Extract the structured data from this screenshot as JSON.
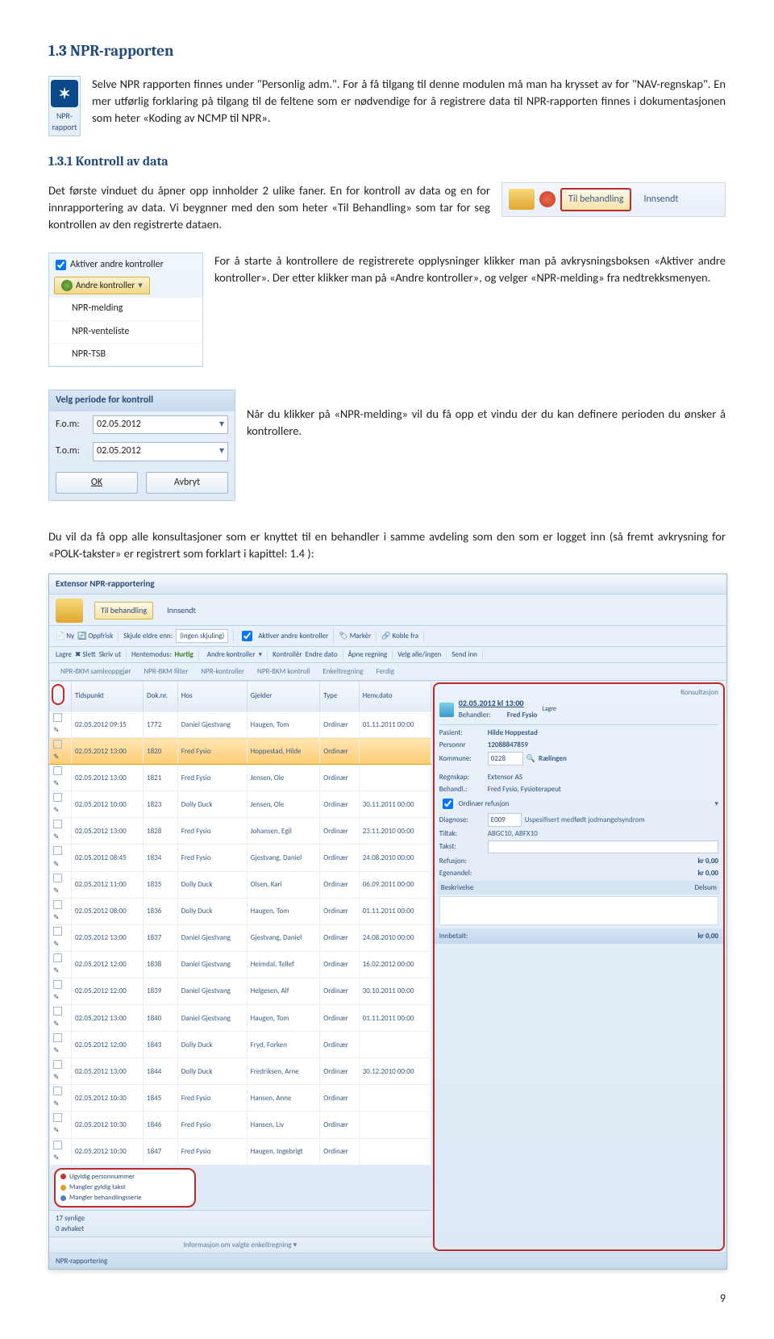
{
  "headings": {
    "h1_3": "1.3   NPR-rapporten",
    "h1_3_1": "1.3.1   Kontroll av data"
  },
  "npr_icon_label": "NPR-rapport",
  "npr_icon_glyph": "✶",
  "para": {
    "p1": "Selve NPR rapporten finnes under \"Personlig adm.\". For å få tilgang til denne modulen må man ha krysset av for \"NAV-regnskap\". En mer utførlig forklaring på tilgang til de feltene som er nødvendige for å registrere data til NPR-rapporten finnes i dokumentasjonen som heter «Koding av NCMP til NPR».",
    "p2": "Det første vinduet du åpner opp innholder 2 ulike faner. En for kontroll av data og en for innrapportering av data. Vi beygnner med den som heter «Til Behandling» som tar for seg kontrollen av den registrerte dataen.",
    "p3": "For å starte å kontrollere de registrerete opplysninger klikker man på avkrysningsboksen «Aktiver andre kontroller». Der etter klikker man på «Andre kontroller», og velger «NPR-melding» fra nedtrekksmenyen.",
    "p4": "Når du klikker på «NPR-melding» vil du få opp et vindu der du kan definere perioden du ønsker å kontrollere.",
    "p5": "Du vil da få opp alle konsultasjoner som er knyttet til en behandler i samme avdeling som den som er logget inn (så fremt avkrysning for «POLK-takster» er registrert som forklart i kapittel: 1.4 ):"
  },
  "tabs_img": {
    "tab1": "Til behandling",
    "tab2": "Innsendt"
  },
  "kontroll": {
    "checkbox_label": "Aktiver andre kontroller",
    "button_label": "Andre kontroller",
    "items": [
      "NPR-melding",
      "NPR-venteliste",
      "NPR-TSB"
    ]
  },
  "periode": {
    "title": "Velg periode for kontroll",
    "fom_lbl": "F.o.m:",
    "tom_lbl": "T.o.m:",
    "fom_val": "02.05.2012",
    "tom_val": "02.05.2012",
    "ok": "OK",
    "cancel": "Avbryt"
  },
  "bigshot": {
    "title": "Extensor NPR-rapportering",
    "top_tabs": {
      "t1": "Til behandling",
      "t2": "Innsendt"
    },
    "tb2": {
      "ny": "Ny",
      "oppfr": "Oppfrisk",
      "skjul": "Skjule eldre enn:",
      "skjul_val": "(ingen skjuling)",
      "aktiver": "Aktiver andre kontroller",
      "marker": "Markèr",
      "koble": "Koble fra",
      "lagre": "Lagre",
      "slett": "Slett",
      "skriv": "Skriv ut",
      "hente": "Hentemodus:",
      "hurtig": "Hurtig",
      "andre": "Andre kontroller",
      "kontrollr": "Kontrollèr",
      "endre": "Endre dato",
      "apne": "Åpne regning",
      "velg": "Velg alle/ingen",
      "send": "Send inn"
    },
    "tb3": [
      "NPR-BKM samleoppgjør",
      "NPR-BKM filter",
      "NPR-kontroller",
      "NPR-BKM kontroll",
      "Enkeltregning",
      "Ferdig"
    ],
    "cols": [
      "",
      "Tidspunkt",
      "Dok.nr.",
      "Hos",
      "Gjelder",
      "Type",
      "Henv.dato"
    ],
    "rows": [
      [
        "",
        "02.05.2012 09:15",
        "1772",
        "Daniel Gjestvang",
        "Haugen, Tom",
        "Ordinær",
        "01.11.2011 00:00"
      ],
      [
        "",
        "02.05.2012 13:00",
        "1820",
        "Fred Fysio",
        "Hoppestad, Hilde",
        "Ordinær",
        ""
      ],
      [
        "",
        "02.05.2012 13:00",
        "1821",
        "Fred Fysio",
        "Jensen, Ole",
        "Ordinær",
        ""
      ],
      [
        "",
        "02.05.2012 10:00",
        "1823",
        "Dolly Duck",
        "Jensen, Ole",
        "Ordinær",
        "30.11.2011 00:00"
      ],
      [
        "",
        "02.05.2012 13:00",
        "1828",
        "Fred Fysio",
        "Johansen, Egil",
        "Ordinær",
        "23.11.2010 00:00"
      ],
      [
        "",
        "02.05.2012 08:45",
        "1834",
        "Fred Fysio",
        "Gjestvang, Daniel",
        "Ordinær",
        "24.08.2010 00:00"
      ],
      [
        "",
        "02.05.2012 11:00",
        "1835",
        "Dolly Duck",
        "Olsen, Kari",
        "Ordinær",
        "06.09.2011 00:00"
      ],
      [
        "",
        "02.05.2012 08:00",
        "1836",
        "Dolly Duck",
        "Haugen, Tom",
        "Ordinær",
        "01.11.2011 00:00"
      ],
      [
        "",
        "02.05.2012 13:00",
        "1837",
        "Daniel Gjestvang",
        "Gjestvang, Daniel",
        "Ordinær",
        "24.08.2010 00:00"
      ],
      [
        "",
        "02.05.2012 12:00",
        "1838",
        "Daniel Gjestvang",
        "Heimdal, Tellef",
        "Ordinær",
        "16.02.2012 00:00"
      ],
      [
        "",
        "02.05.2012 12:00",
        "1839",
        "Daniel Gjestvang",
        "Helgesen, Alf",
        "Ordinær",
        "30.10.2011 00:00"
      ],
      [
        "",
        "02.05.2012 13:00",
        "1840",
        "Daniel Gjestvang",
        "Haugen, Tom",
        "Ordinær",
        "01.11.2011 00:00"
      ],
      [
        "",
        "02.05.2012 12:00",
        "1843",
        "Dolly Duck",
        "Fryd, Forken",
        "Ordinær",
        ""
      ],
      [
        "",
        "02.05.2012 13:00",
        "1844",
        "Dolly Duck",
        "Fredriksen, Arne",
        "Ordinær",
        "30.12.2010 00:00"
      ],
      [
        "",
        "02.05.2012 10:30",
        "1845",
        "Fred Fysio",
        "Hansen, Anne",
        "Ordinær",
        ""
      ],
      [
        "",
        "02.05.2012 10:30",
        "1846",
        "Fred Fysio",
        "Hansen, Liv",
        "Ordinær",
        ""
      ],
      [
        "",
        "02.05.2012 10:30",
        "1847",
        "Fred Fysio",
        "Haugen, Ingebrigt",
        "Ordinær",
        ""
      ]
    ],
    "highlight_row_index": 1,
    "legend": [
      "Ugyldig personnummer",
      "Mangler gyldig takst",
      "Mangler behandlingsserie"
    ],
    "footer_left": "17 synlige\n0 avhaket",
    "mid_info": "Informasjon om valgte enkeltregning  ▾",
    "footer_bar": "NPR-rapportering",
    "side": {
      "konsult": "Konsultasjon",
      "date_line": "02.05.2012  kl  13:00",
      "lagre": "Lagre",
      "behandler_lbl": "Behandler:",
      "behandler": "Fred Fysio",
      "pasient_lbl": "Pasient:",
      "pasient": "Hilde Hoppestad",
      "personnr_lbl": "Personnr",
      "personnr": "12088847859",
      "kommune_lbl": "Kommune:",
      "kommune_kode": "0228",
      "kommune": "Rælingen",
      "regnskap_lbl": "Regnskap:",
      "regnskap": "Extensor AS",
      "behandl_lbl": "Behandl.:",
      "behandl": "Fred Fysio, Fysioterapeut",
      "ord_ref": "Ordinær refusjon",
      "diagnose_lbl": "Diagnose:",
      "diagnose_kode": "E009",
      "diagnose": "Uspesifisert medfødt jodmangelsyndrom",
      "tiltak_lbl": "Tiltak:",
      "tiltak": "ABGC10, ABFX10",
      "takst_lbl": "Takst:",
      "refusjon": "Refusjon:",
      "egenandel": "Egenandel:",
      "kr0": "kr 0,00",
      "beskriv_lbl": "Beskrivelse",
      "delsum": "Delsum",
      "innbet": "Innbetalt:"
    }
  },
  "page_number": "9"
}
